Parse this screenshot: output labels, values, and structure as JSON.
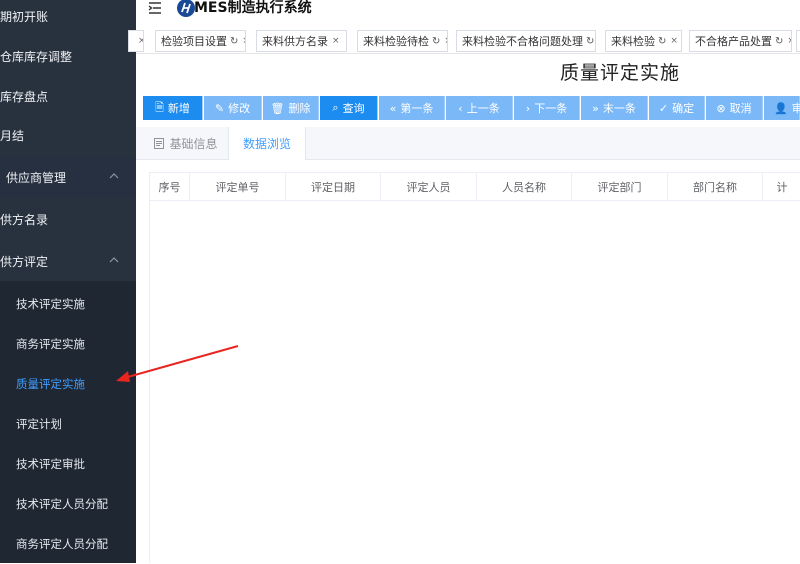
{
  "header": {
    "title": "MES制造执行系统"
  },
  "sidebar": {
    "items": [
      {
        "label": "期初开账"
      },
      {
        "label": "仓库库存调整"
      },
      {
        "label": "库存盘点"
      },
      {
        "label": "月结"
      },
      {
        "label": "供应商管理"
      },
      {
        "label": "供方名录"
      },
      {
        "label": "供方评定"
      }
    ],
    "sub_items": [
      {
        "label": "技术评定实施"
      },
      {
        "label": "商务评定实施"
      },
      {
        "label": "质量评定实施"
      },
      {
        "label": "评定计划"
      },
      {
        "label": "技术评定审批"
      },
      {
        "label": "技术评定人员分配"
      },
      {
        "label": "商务评定人员分配"
      }
    ]
  },
  "tags": [
    {
      "label": "检验项目设置"
    },
    {
      "label": "来料供方名录"
    },
    {
      "label": "来料检验待检"
    },
    {
      "label": "来料检验不合格问题处理"
    },
    {
      "label": "来料检验"
    },
    {
      "label": "不合格产品处置"
    }
  ],
  "page": {
    "title": "质量评定实施"
  },
  "toolbar": {
    "buttons": [
      {
        "label": "新增"
      },
      {
        "label": "修改"
      },
      {
        "label": "删除"
      },
      {
        "label": "查询"
      },
      {
        "label": "第一条"
      },
      {
        "label": "上一条"
      },
      {
        "label": "下一条"
      },
      {
        "label": "末一条"
      },
      {
        "label": "确定"
      },
      {
        "label": "取消"
      },
      {
        "label": "审"
      }
    ]
  },
  "tabs": [
    {
      "label": "基础信息"
    },
    {
      "label": "数据浏览"
    }
  ],
  "table": {
    "columns": [
      "序号",
      "评定单号",
      "评定日期",
      "评定人员",
      "人员名称",
      "评定部门",
      "部门名称",
      "计"
    ]
  },
  "colors": {
    "sidebar_bg": "#28323e",
    "accent": "#409eff",
    "primary_button": "#1d8cf0",
    "button": "#7bb8f7",
    "arrow": "#e8251f"
  }
}
